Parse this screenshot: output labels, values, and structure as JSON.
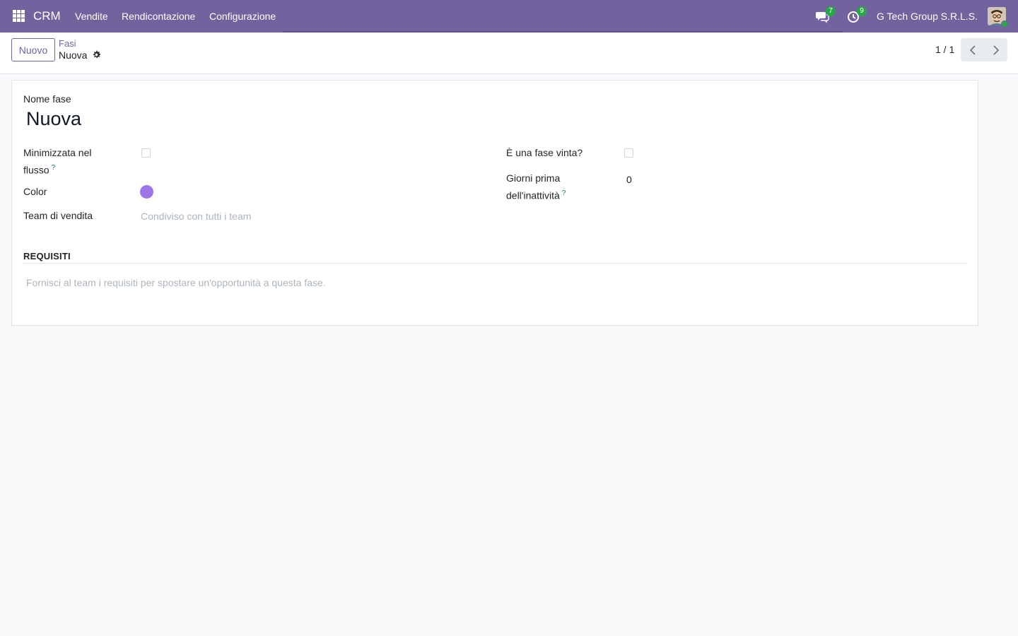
{
  "navbar": {
    "app_name": "CRM",
    "menu": [
      "Vendite",
      "Rendicontazione",
      "Configurazione"
    ],
    "messages_count": "7",
    "activities_count": "9",
    "company": "G Tech Group S.R.L.S.",
    "accent_color": "#71639e"
  },
  "control_panel": {
    "new_button": "Nuovo",
    "breadcrumb_parent": "Fasi",
    "breadcrumb_current": "Nuova",
    "pager": "1 / 1"
  },
  "form": {
    "name_label": "Nome fase",
    "name_value": "Nuova",
    "fold_label_line1": "Minimizzata nel",
    "fold_label_line2": "flusso",
    "fold_checked": false,
    "color_label": "Color",
    "color_value": "#9d75e9",
    "team_label": "Team di vendita",
    "team_placeholder": "Condiviso con tutti i team",
    "won_label": "È una fase vinta?",
    "won_checked": false,
    "rotting_label_line1": "Giorni prima",
    "rotting_label_line2": "dell'inattività",
    "rotting_value": "0",
    "help_mark": "?"
  },
  "requirements": {
    "title": "REQUISITI",
    "placeholder": "Fornisci al team i requisiti per spostare un'opportunità a questa fase."
  }
}
